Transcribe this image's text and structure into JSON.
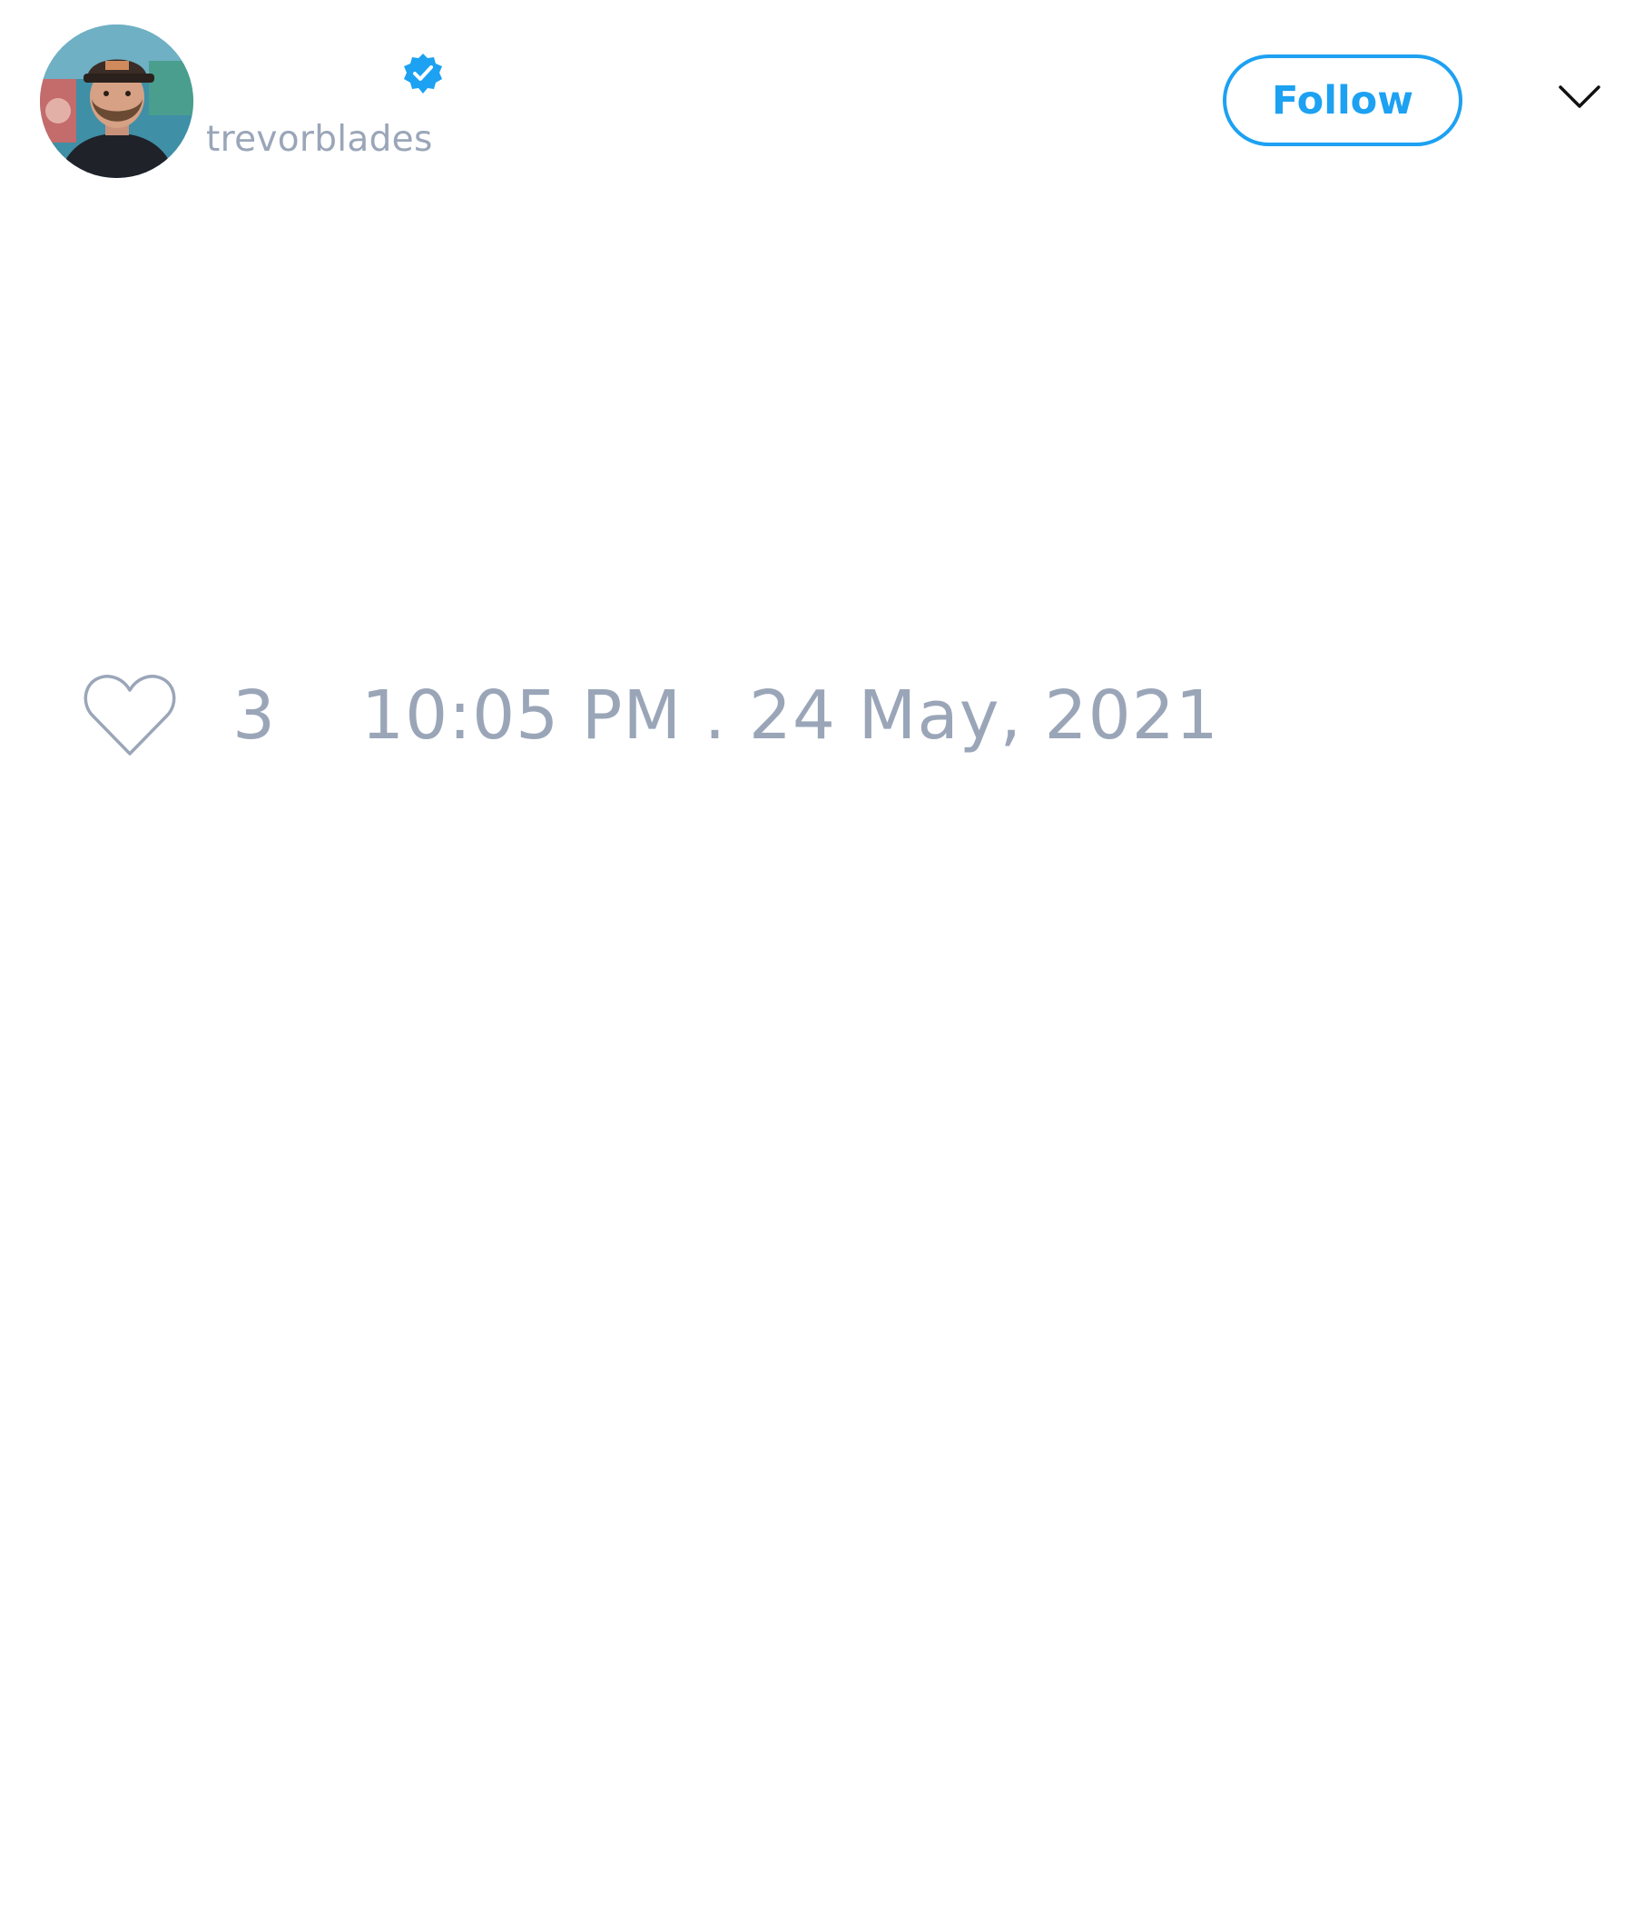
{
  "colors": {
    "accent": "#1da1f2",
    "muted_text": "#9aa6b8",
    "background": "#ffffff"
  },
  "header": {
    "avatar_icon": "profile-photo",
    "verified_icon": "verified-badge",
    "username": "trevorblades",
    "follow_label": "Follow",
    "menu_icon": "chevron-down"
  },
  "footer": {
    "like_icon": "heart",
    "like_count": "3",
    "timestamp": "10:05 PM . 24 May, 2021"
  }
}
